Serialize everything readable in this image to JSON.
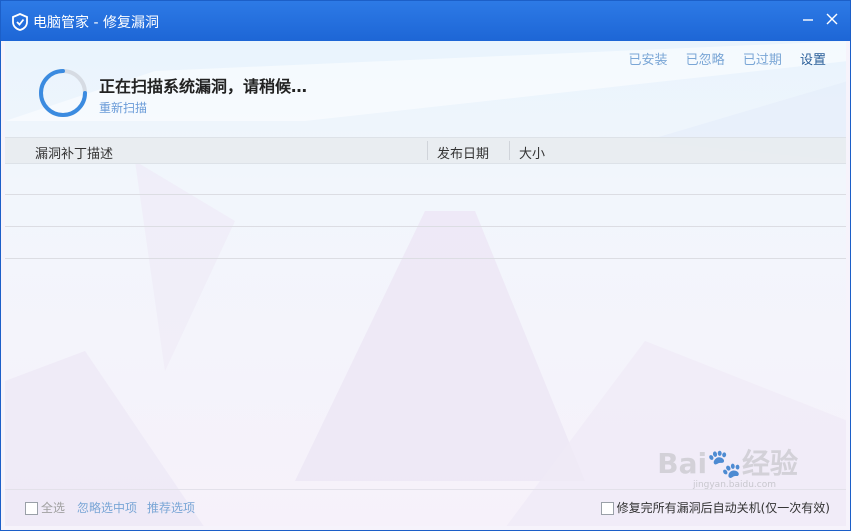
{
  "window": {
    "title": "电脑管家 - 修复漏洞"
  },
  "icons": {
    "logo": "shield-icon",
    "minimize": "minimize-icon",
    "close": "close-icon",
    "spinner": "loading-spinner-icon"
  },
  "colors": {
    "titlebar": "#1d66d6",
    "link": "#7aa6d6",
    "spinner": "#3b8be0"
  },
  "top_links": [
    "已安装",
    "已忽略",
    "已过期",
    "设置"
  ],
  "scan": {
    "title": "正在扫描系统漏洞，请稍候…",
    "rescan_label": "重新扫描"
  },
  "table": {
    "columns": [
      "漏洞补丁描述",
      "发布日期",
      "大小"
    ]
  },
  "footer": {
    "select_all": "全选",
    "ignore_selected": "忽略选中项",
    "recommended": "推荐选项",
    "auto_shutdown": "修复完所有漏洞后自动关机(仅一次有效)"
  },
  "watermark": {
    "brand": "Bai",
    "suffix": "经验",
    "sub": "jingyan.baidu.com"
  }
}
